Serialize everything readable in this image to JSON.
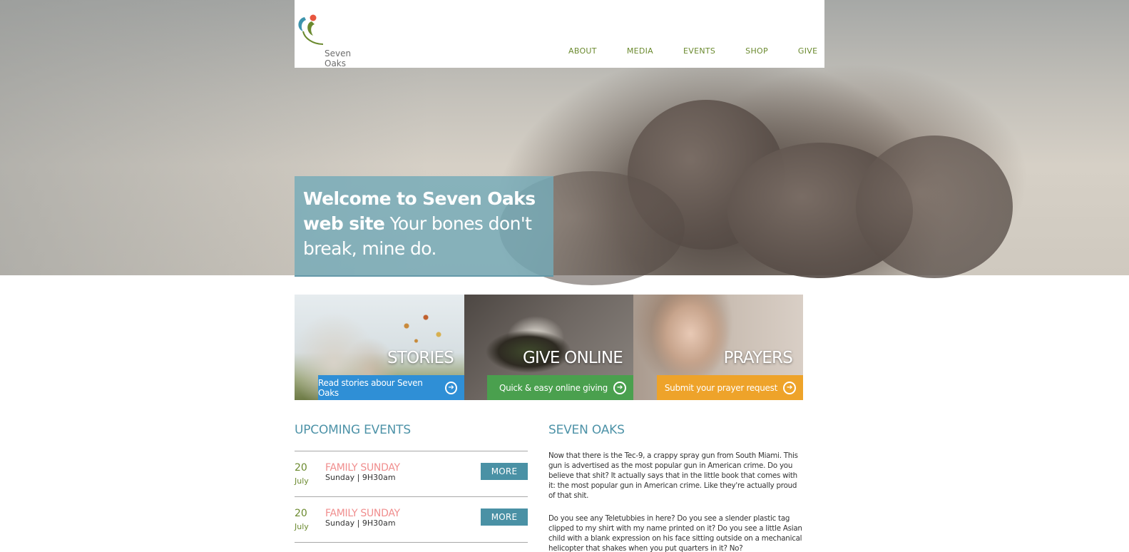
{
  "brand": {
    "name": "Seven Oaks"
  },
  "nav": {
    "items": [
      {
        "label": "ABOUT"
      },
      {
        "label": "MEDIA"
      },
      {
        "label": "EVENTS"
      },
      {
        "label": "SHOP"
      },
      {
        "label": "GIVE"
      }
    ]
  },
  "hero": {
    "welcome_bold": "Welcome to Seven Oaks web site",
    "welcome_light": "Your bones don't break, mine do."
  },
  "tiles": [
    {
      "heading": "STORIES",
      "link": "Read stories abour Seven Oaks",
      "color": "#2f8fd6"
    },
    {
      "heading": "GIVE ONLINE",
      "link": "Quick & easy online giving",
      "color": "#4aa04e"
    },
    {
      "heading": "PRAYERS",
      "link": "Submit your prayer request",
      "color": "#eea32a"
    }
  ],
  "events": {
    "title": "UPCOMING EVENTS",
    "items": [
      {
        "day": "20",
        "month": "July",
        "name": "FAMILY SUNDAY",
        "time": "Sunday | 9H30am",
        "button": "MORE"
      },
      {
        "day": "20",
        "month": "July",
        "name": "FAMILY SUNDAY",
        "time": "Sunday | 9H30am",
        "button": "MORE"
      }
    ]
  },
  "about": {
    "title": "SEVEN OAKS",
    "paragraphs": [
      "Now that there is the Tec-9, a crappy spray gun from South Miami. This gun is advertised as the most popular gun in American crime. Do you believe that shit? It actually says that in the little book that comes with it: the most popular gun in American crime. Like they're actually proud of that shit.",
      "Do you see any Teletubbies in here? Do you see a slender plastic tag clipped to my shirt with my name printed on it? Do you see a little Asian child with a blank expression on his face sitting outside on a mechanical helicopter that shakes when you put quarters in it? No?"
    ]
  },
  "colors": {
    "accent": "#4e93a8",
    "nav": "#6b8a2f",
    "event_name": "#f08e8e"
  }
}
